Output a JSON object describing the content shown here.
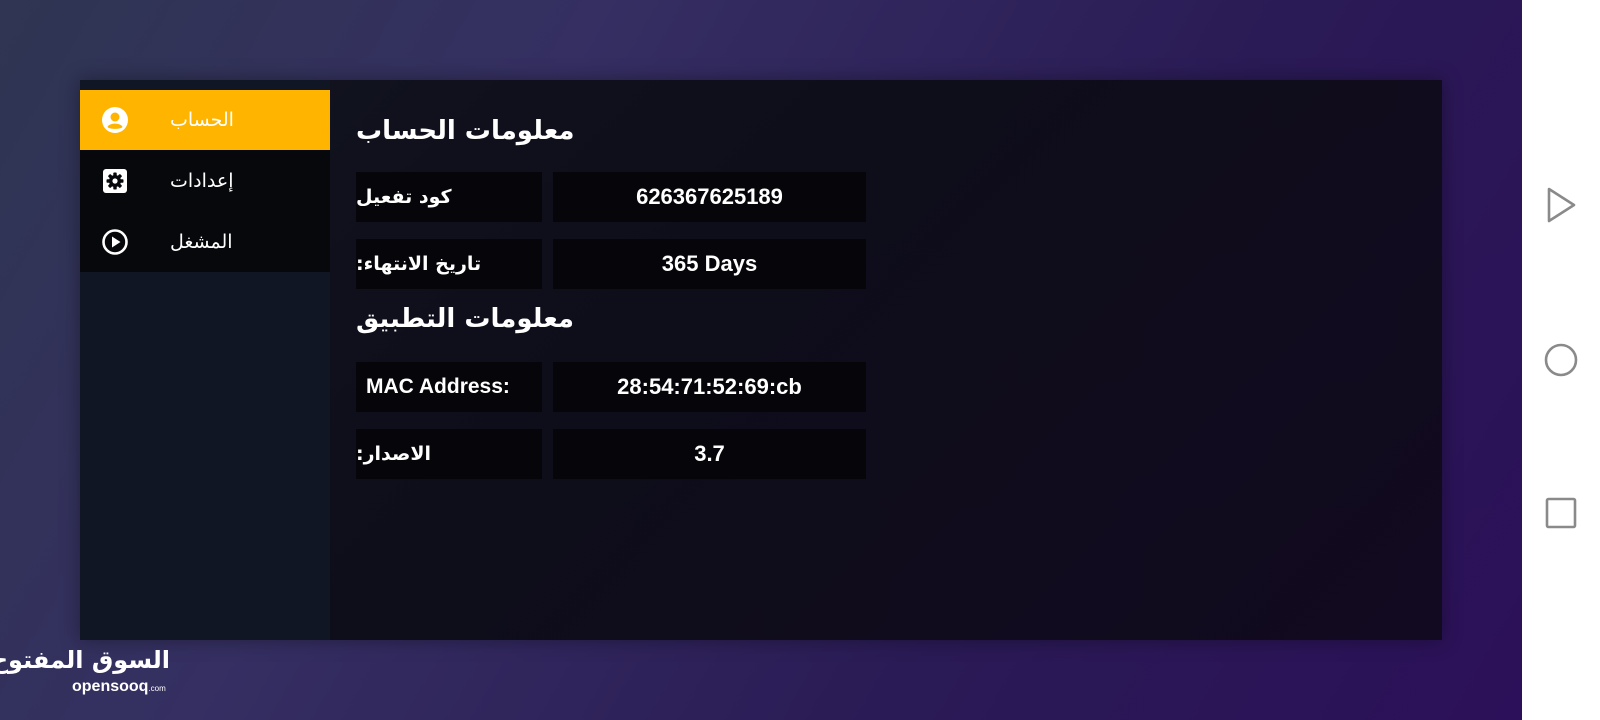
{
  "sidebar": {
    "items": [
      {
        "label": "الحساب",
        "icon": "account-circle-icon",
        "active": true
      },
      {
        "label": "إعدادات",
        "icon": "gear-icon",
        "active": false
      },
      {
        "label": "المشغل",
        "icon": "play-circle-icon",
        "active": false
      }
    ]
  },
  "account_section": {
    "title": "معلومات الحساب",
    "rows": [
      {
        "label": "كود تفعيل",
        "value": "626367625189"
      },
      {
        "label": "تاريخ الانتهاء:",
        "value": "365 Days"
      }
    ]
  },
  "app_section": {
    "title": "معلومات التطبيق",
    "rows": [
      {
        "label": "MAC Address:",
        "value": "28:54:71:52:69:cb"
      },
      {
        "label": "الاصدار:",
        "value": "3.7"
      }
    ]
  },
  "watermark": {
    "arabic": "السوق المفتوح",
    "latin": "opensooq",
    "suffix": ".com"
  },
  "colors": {
    "accent": "#ffb400",
    "panel": "#0f101c",
    "cell": "#06060a"
  }
}
